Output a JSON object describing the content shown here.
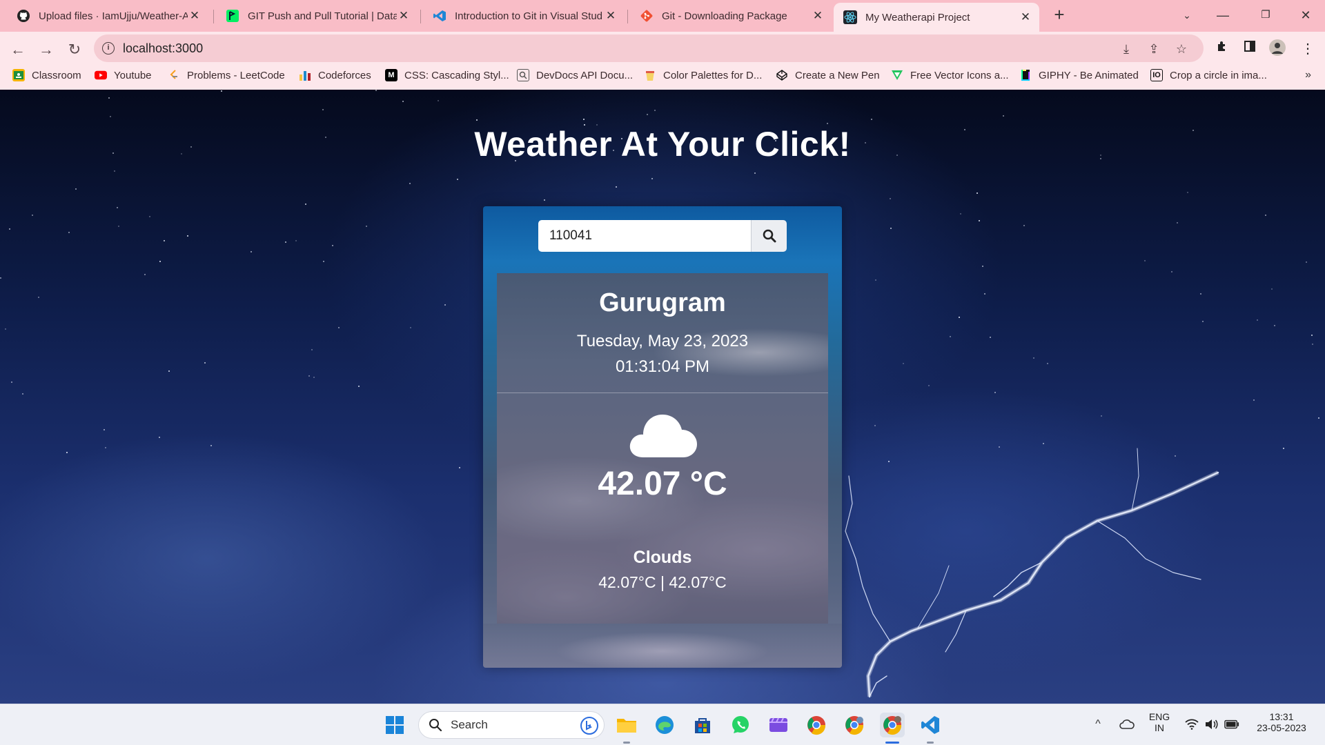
{
  "browser": {
    "tabs": [
      {
        "title": "Upload files · IamUjju/Weather-A",
        "icon": "github-icon"
      },
      {
        "title": "GIT Push and Pull Tutorial | DataC",
        "icon": "datacamp-icon"
      },
      {
        "title": "Introduction to Git in Visual Stud",
        "icon": "vscode-icon"
      },
      {
        "title": "Git - Downloading Package",
        "icon": "git-icon"
      },
      {
        "title": "My Weatherapi Project",
        "icon": "react-icon",
        "active": true
      }
    ],
    "address": "localhost:3000",
    "bookmarks": [
      {
        "label": "Classroom",
        "icon": "classroom-icon",
        "color": "#1e8e3e"
      },
      {
        "label": "Youtube",
        "icon": "youtube-icon",
        "color": "#ff0000"
      },
      {
        "label": "Problems - LeetCode",
        "icon": "leetcode-icon",
        "color": "#f89f1b"
      },
      {
        "label": "Codeforces",
        "icon": "codeforces-icon",
        "color": "#1f8acb"
      },
      {
        "label": "CSS: Cascading Styl...",
        "icon": "mdn-icon",
        "color": "#000000"
      },
      {
        "label": "DevDocs API Docu...",
        "icon": "devdocs-icon",
        "color": "#555555"
      },
      {
        "label": "Color Palettes for D...",
        "icon": "colorhunt-icon",
        "color": "#e0a030"
      },
      {
        "label": "Create a New Pen",
        "icon": "codepen-icon",
        "color": "#000000"
      },
      {
        "label": "Free Vector Icons a...",
        "icon": "flaticon-icon",
        "color": "#22c55e"
      },
      {
        "label": "GIPHY - Be Animated",
        "icon": "giphy-icon",
        "color": "#000000"
      },
      {
        "label": "Crop a circle in ima...",
        "icon": "io-icon",
        "color": "#000000"
      }
    ]
  },
  "page": {
    "title": "Weather At Your Click!",
    "search_value": "110041",
    "city": "Gurugram",
    "date": "Tuesday, May 23, 2023",
    "time": "01:31:04 PM",
    "temperature": "42.07 °C",
    "condition": "Clouds",
    "min_max": "42.07°C | 42.07°C",
    "weather_icon": "cloud-icon"
  },
  "taskbar": {
    "search_placeholder": "Search",
    "lang_top": "ENG",
    "lang_bottom": "IN",
    "clock_time": "13:31",
    "clock_date": "23-05-2023"
  },
  "colors": {
    "tab_strip": "#f9bdc7",
    "toolbar": "#fde7eb",
    "card_top": "#0e5aa0",
    "page_bg": "#0e1d4a"
  }
}
